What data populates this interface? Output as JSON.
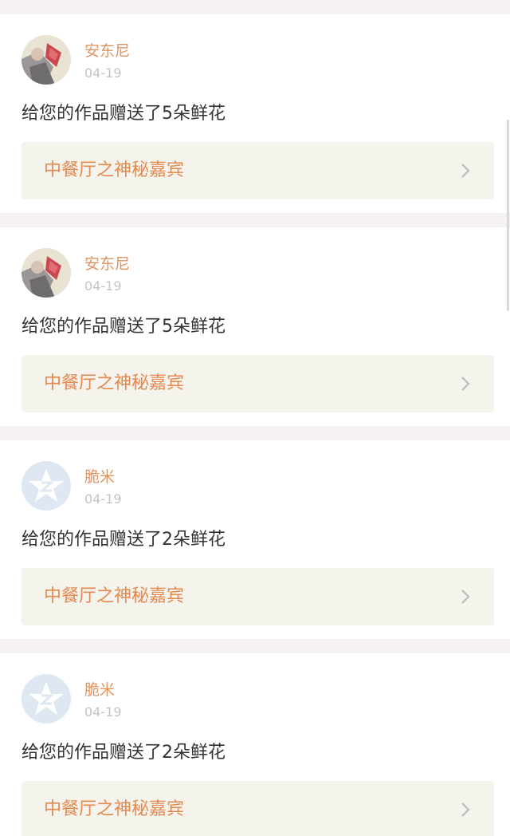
{
  "notifications": [
    {
      "user": {
        "name": "安东尼",
        "avatar": "photo-avatar-icon"
      },
      "date": "04-19",
      "message": "给您的作品赠送了5朵鲜花",
      "work": {
        "title": "中餐厅之神秘嘉宾"
      }
    },
    {
      "user": {
        "name": "安东尼",
        "avatar": "photo-avatar-icon"
      },
      "date": "04-19",
      "message": "给您的作品赠送了5朵鲜花",
      "work": {
        "title": "中餐厅之神秘嘉宾"
      }
    },
    {
      "user": {
        "name": "脆米",
        "avatar": "default-star-avatar-icon"
      },
      "date": "04-19",
      "message": "给您的作品赠送了2朵鲜花",
      "work": {
        "title": "中餐厅之神秘嘉宾"
      }
    },
    {
      "user": {
        "name": "脆米",
        "avatar": "default-star-avatar-icon"
      },
      "date": "04-19",
      "message": "给您的作品赠送了2朵鲜花",
      "work": {
        "title": "中餐厅之神秘嘉宾"
      }
    }
  ],
  "colors": {
    "accent": "#e09461",
    "link_background": "#f4f3ec",
    "separator": "#f6f2f2",
    "default_avatar": "#dfe8f2"
  }
}
